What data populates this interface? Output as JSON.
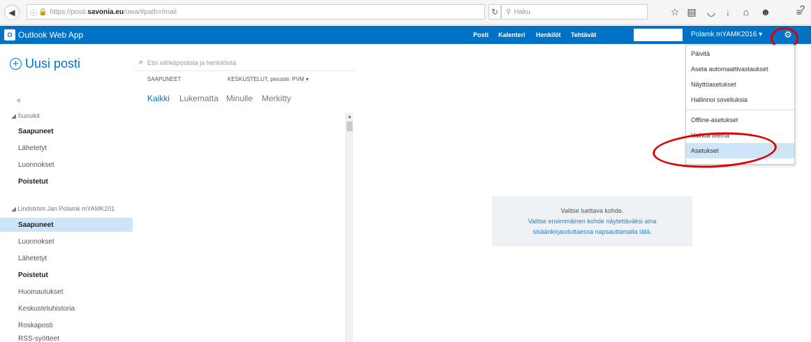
{
  "browser": {
    "url_prefix": "https://posti.",
    "url_domain": "savonia.eu",
    "url_suffix": "/owa/#path=/mail",
    "search_placeholder": "Haku"
  },
  "owa": {
    "app_title": "Outlook Web App",
    "logo_text": "O",
    "nav": [
      "Posti",
      "Kalenteri",
      "Henkilöt",
      "Tehtävät"
    ],
    "user_name": "Polamk mYAMK2016",
    "user_caret": "▾",
    "help": "?"
  },
  "left_nav": {
    "new_mail": "Uusi posti",
    "collapse": "«",
    "favorites_header": "Suosikit",
    "favorites": [
      {
        "label": "Saapuneet",
        "bold": true
      },
      {
        "label": "Lähetetyt",
        "bold": false
      },
      {
        "label": "Luonnokset",
        "bold": false
      },
      {
        "label": "Poistetut",
        "bold": true
      }
    ],
    "account_header": "Lindström Jan Polamk mYAMK201",
    "folders": [
      {
        "label": "Saapuneet",
        "bold": true
      },
      {
        "label": "Luonnokset",
        "bold": false
      },
      {
        "label": "Lähetetyt",
        "bold": false
      },
      {
        "label": "Poistetut",
        "bold": true
      },
      {
        "label": "Huomautukset",
        "bold": false
      },
      {
        "label": "Keskusteluhistoria",
        "bold": false
      },
      {
        "label": "Roskaposti",
        "bold": false
      },
      {
        "label": "RSS-syötteet",
        "bold": false
      }
    ]
  },
  "mail_list": {
    "search_placeholder": "Etsi sähköpostista ja henkilöistä",
    "inbox_label": "SAAPUNEET",
    "sort_label": "KESKUSTELUT, peruste: PVM",
    "sort_caret": "▾",
    "filters": [
      "Kaikki",
      "Lukematta",
      "Minulle",
      "Merkitty"
    ]
  },
  "reading_pane": {
    "line1": "Valitse luettava kohde.",
    "line2": "Valitse ensimmäinen kohde näytettäväksi aina",
    "line3": "sisäänkirjauduttaessa napsauttamalla tätä."
  },
  "settings_menu": {
    "items": [
      "Päivitä",
      "Aseta automaattivastaukset",
      "Näyttöasetukset",
      "Hallinnoi sovelluksia",
      "Offline-asetukset",
      "Vaihda teema",
      "Asetukset"
    ],
    "selected_index": 6
  },
  "colors": {
    "owa_blue": "#0072c6",
    "selection": "#cde6f7",
    "highlight_ring": "#e00000"
  }
}
